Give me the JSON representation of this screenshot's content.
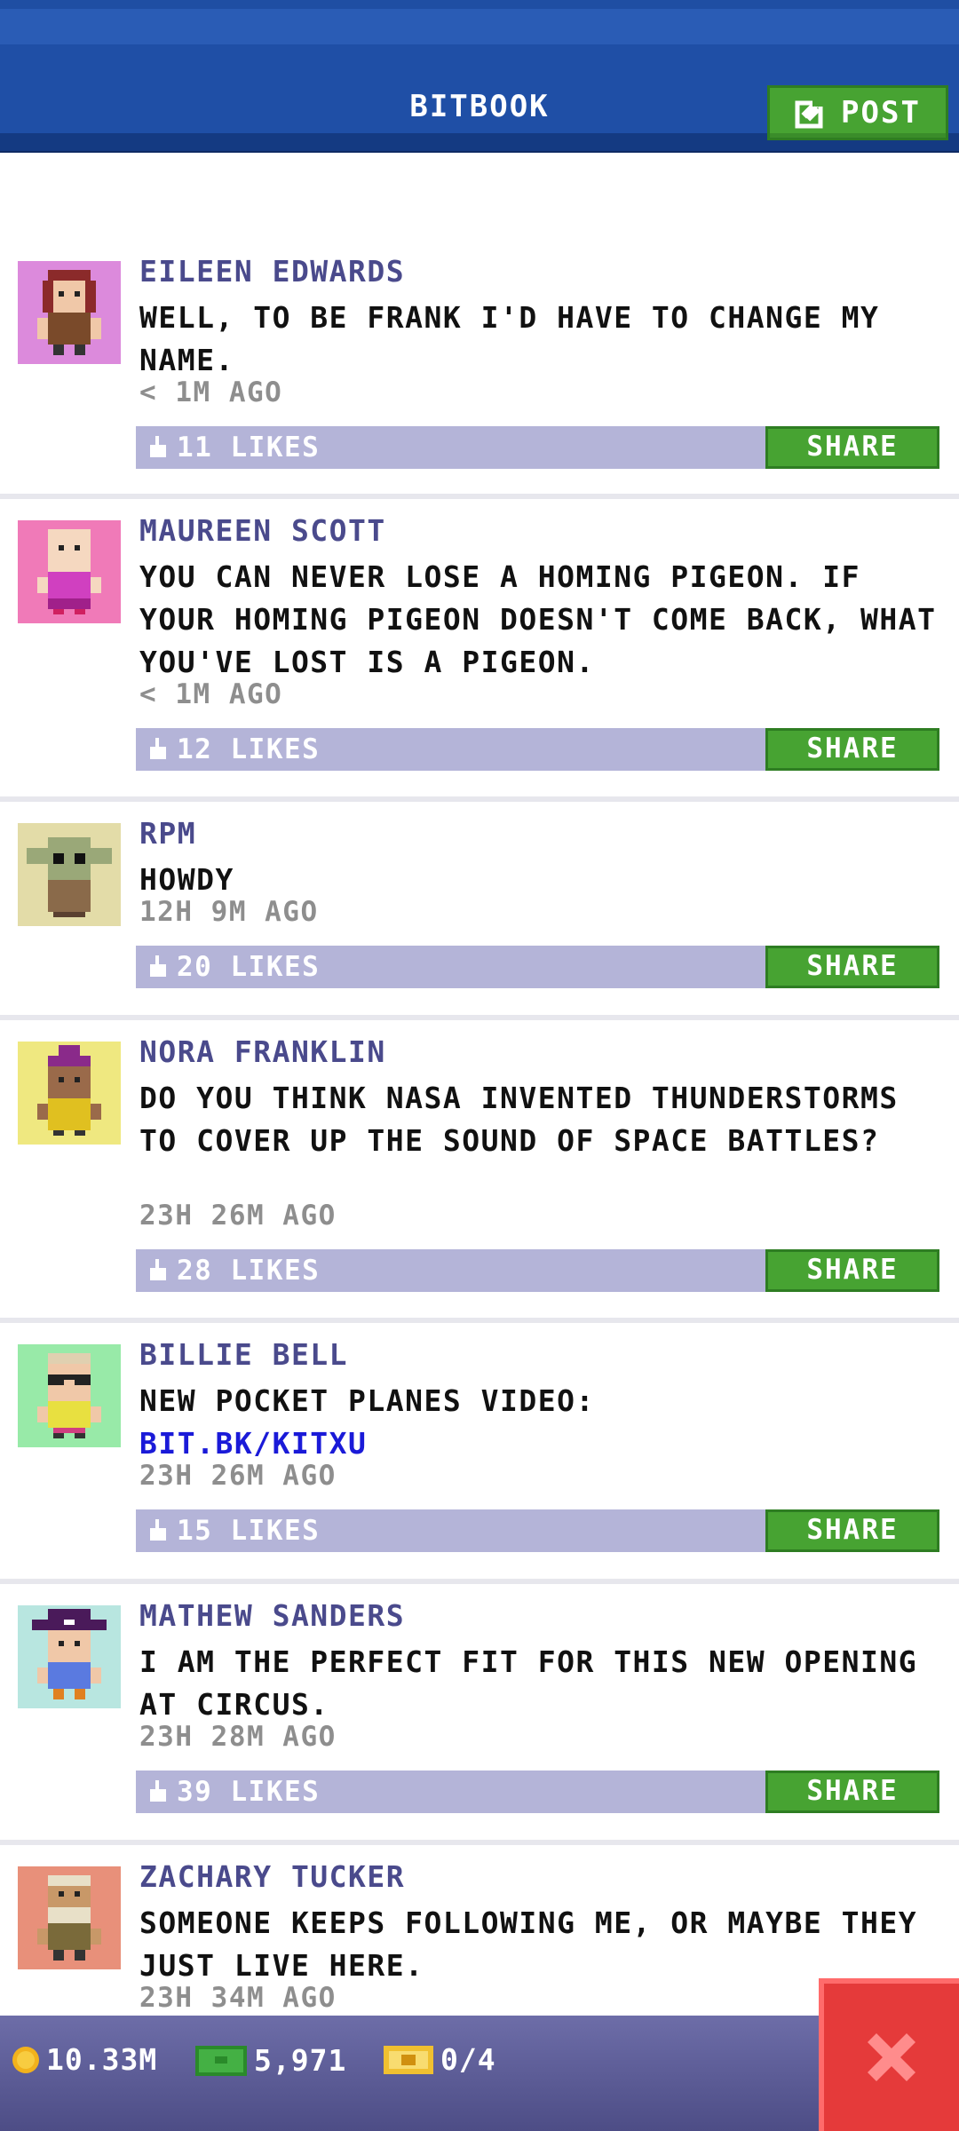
{
  "header": {
    "title": "BITBOOK",
    "post_label": "POST"
  },
  "colors": {
    "header_blue": "#1f4fa6",
    "accent_green": "#47a332",
    "like_bar": "#b4b4d8",
    "name_purple": "#4a4a8c",
    "close_red": "#e53a3a"
  },
  "posts": [
    {
      "name": "EILEEN EDWARDS",
      "message": "WELL, TO BE FRANK I'D HAVE TO CHANGE MY NAME.",
      "time": "< 1M AGO",
      "likes": "11 LIKES",
      "share": "SHARE",
      "avatar": "red-hair-woman-avatar"
    },
    {
      "name": "MAUREEN SCOTT",
      "message": "YOU CAN NEVER LOSE A HOMING PIGEON. IF YOUR HOMING PIGEON DOESN'T COME BACK, WHAT YOU'VE LOST IS A PIGEON.",
      "time": "< 1M AGO",
      "likes": "12 LIKES",
      "share": "SHARE",
      "avatar": "bald-pink-avatar"
    },
    {
      "name": "RPM",
      "message": "HOWDY",
      "time": "12H 9M AGO",
      "likes": "20 LIKES",
      "share": "SHARE",
      "avatar": "green-alien-avatar"
    },
    {
      "name": "NORA FRANKLIN",
      "message": "DO YOU THINK NASA INVENTED THUNDERSTORMS TO COVER UP THE SOUND OF SPACE BATTLES?",
      "time": "23H 26M AGO",
      "likes": "28 LIKES",
      "share": "SHARE",
      "avatar": "purple-hat-avatar"
    },
    {
      "name": "BILLIE BELL",
      "message": "NEW POCKET PLANES VIDEO:",
      "link": "BIT.BK/KITXU",
      "time": "23H 26M AGO",
      "likes": "15 LIKES",
      "share": "SHARE",
      "avatar": "glasses-avatar"
    },
    {
      "name": "MATHEW SANDERS",
      "message": "I AM THE PERFECT FIT FOR THIS NEW OPENING AT CIRCUS.",
      "time": "23H 28M AGO",
      "likes": "39 LIKES",
      "share": "SHARE",
      "avatar": "pirate-hat-avatar"
    },
    {
      "name": "ZACHARY TUCKER",
      "message": "SOMEONE KEEPS FOLLOWING ME, OR MAYBE THEY JUST LIVE HERE.",
      "time": "23H 34M AGO",
      "likes": "",
      "share": "",
      "avatar": "bearded-man-avatar"
    }
  ],
  "footer": {
    "coins": "10.33M",
    "bux": "5,971",
    "tickets": "0/4"
  }
}
